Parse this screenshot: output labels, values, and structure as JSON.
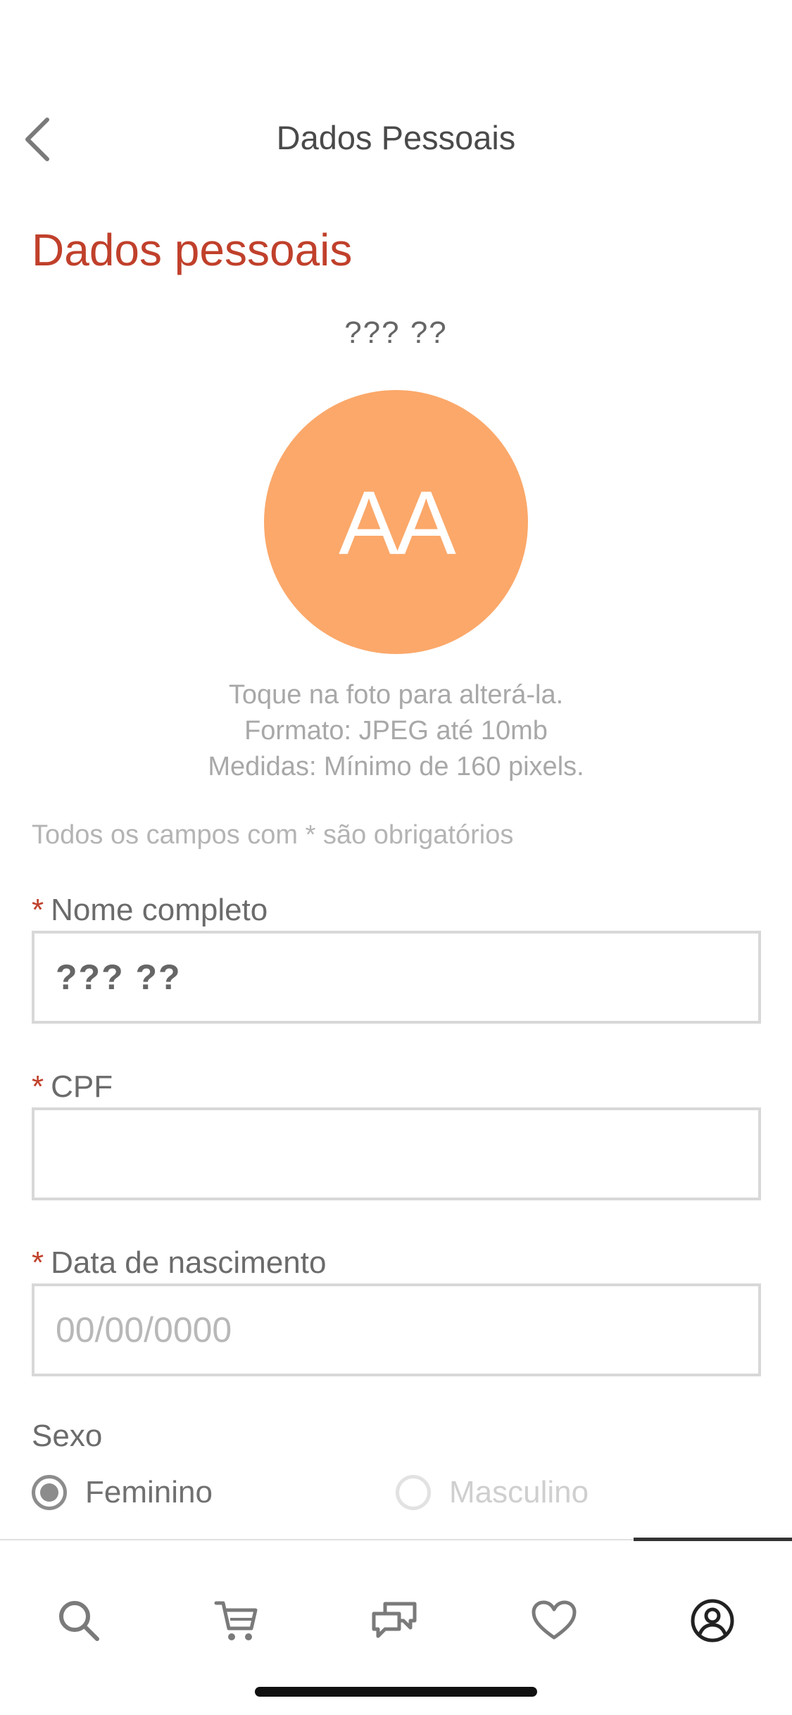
{
  "header": {
    "title": "Dados Pessoais",
    "back_icon": "chevron-left-icon"
  },
  "section": {
    "title": "Dados pessoais"
  },
  "profile": {
    "name": "??? ??",
    "initials": "AA",
    "avatar_color": "#fba86a",
    "hint_lines": [
      "Toque na foto para alterá-la.",
      "Formato: JPEG até 10mb",
      "Medidas: Mínimo de 160 pixels."
    ]
  },
  "form": {
    "required_note": "Todos os campos com * são obrigatórios",
    "required_mark": "*",
    "fields": [
      {
        "label": "Nome completo",
        "value": "??? ??",
        "placeholder": ""
      },
      {
        "label": "CPF",
        "value": "",
        "placeholder": ""
      },
      {
        "label": "Data de nascimento",
        "value": "",
        "placeholder": "00/00/0000"
      }
    ],
    "sex": {
      "label": "Sexo",
      "options": [
        {
          "label": "Feminino",
          "selected": true
        },
        {
          "label": "Masculino",
          "selected": false
        }
      ]
    }
  },
  "tabbar": {
    "items": [
      {
        "icon": "search-icon",
        "active": false
      },
      {
        "icon": "cart-icon",
        "active": false
      },
      {
        "icon": "chat-icon",
        "active": false
      },
      {
        "icon": "heart-icon",
        "active": false
      },
      {
        "icon": "user-circle-icon",
        "active": true
      }
    ]
  },
  "colors": {
    "accent": "#c0402b",
    "avatar": "#fba86a"
  }
}
